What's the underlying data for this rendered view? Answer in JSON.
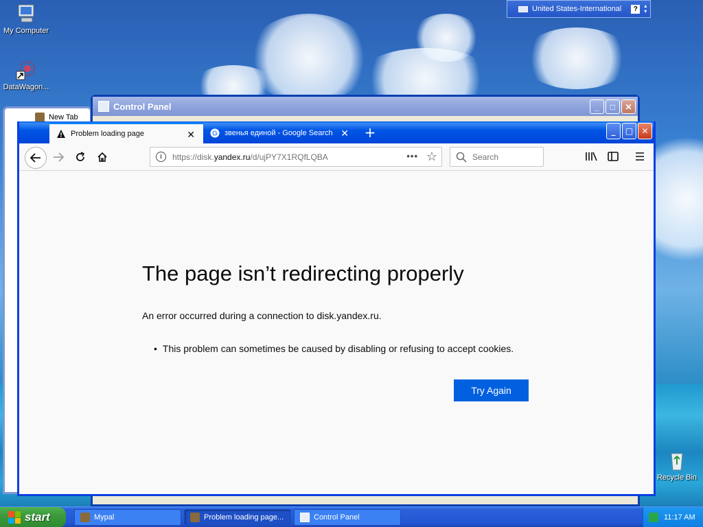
{
  "desktop": {
    "icons": [
      {
        "label": "My Computer"
      },
      {
        "label": "DataWagon..."
      },
      {
        "label": "Recycle Bin"
      }
    ],
    "language_bar": {
      "label": "United States-International",
      "help": "?"
    }
  },
  "background_windows": {
    "control_panel": {
      "title": "Control Panel"
    },
    "new_tab": {
      "title": "New Tab"
    }
  },
  "browser": {
    "tabs": [
      {
        "label": "Problem loading page",
        "active": true,
        "icon": "warning-icon"
      },
      {
        "label": "звенья единой - Google Search",
        "active": false,
        "icon": "google-icon"
      }
    ],
    "url": "https://disk.yandex.ru/d/ujPY7X1RQfLQBA",
    "url_domain_highlight": "yandex.ru",
    "search_placeholder": "Search"
  },
  "error_page": {
    "title": "The page isn’t redirecting properly",
    "description": "An error occurred during a connection to disk.yandex.ru.",
    "bullets": [
      "This problem can sometimes be caused by disabling or refusing to accept cookies."
    ],
    "button": "Try Again"
  },
  "taskbar": {
    "start": "start",
    "tasks": [
      {
        "label": "Mypal",
        "active": false
      },
      {
        "label": "Problem loading page...",
        "active": true
      },
      {
        "label": "Control Panel",
        "active": false
      }
    ],
    "clock": "11:17 AM"
  },
  "colors": {
    "accent": "#0060df",
    "xp_blue": "#0055e5",
    "start_green": "#3c9a3c"
  }
}
